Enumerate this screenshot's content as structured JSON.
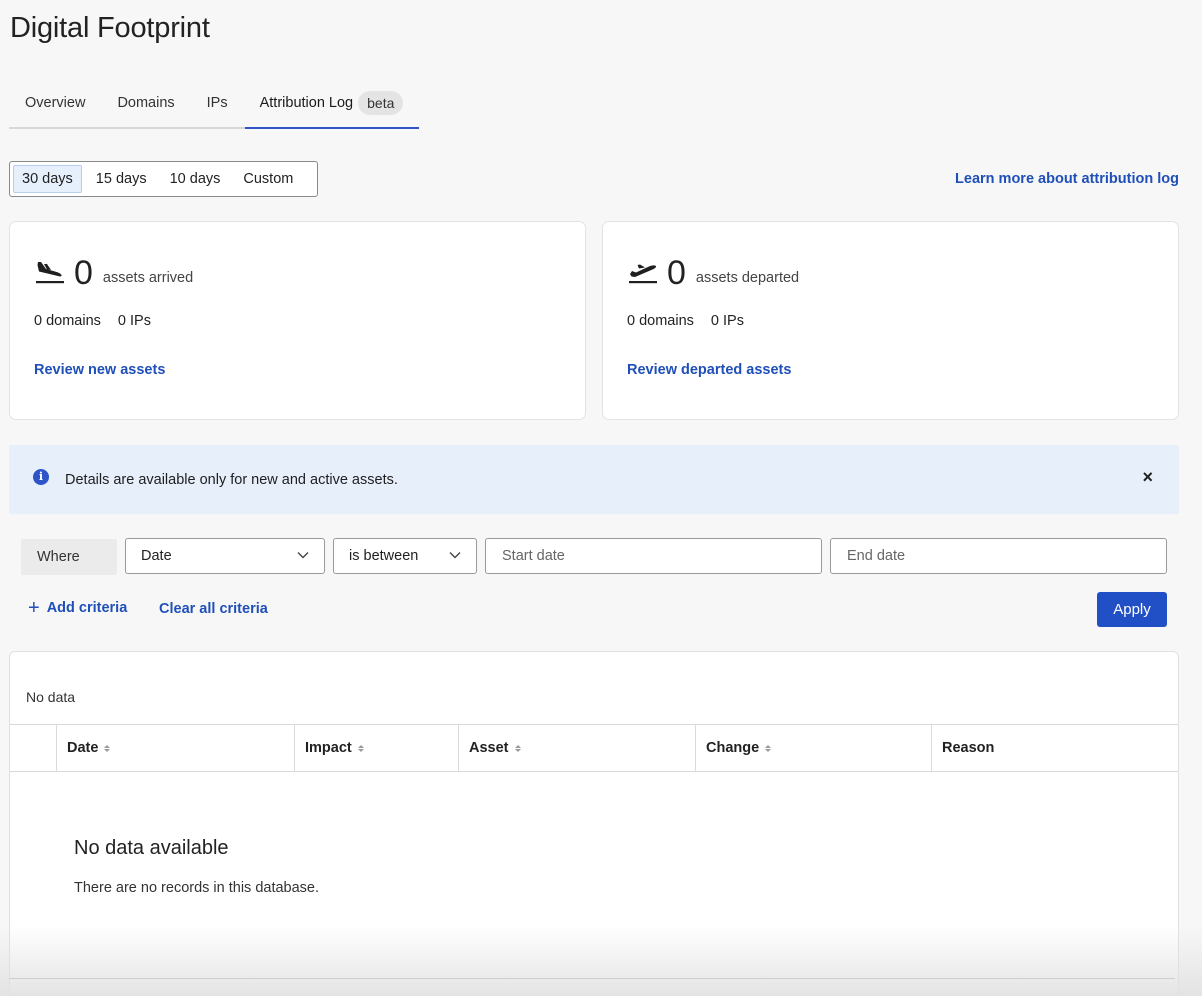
{
  "page": {
    "title": "Digital Footprint"
  },
  "tabs": [
    {
      "label": "Overview"
    },
    {
      "label": "Domains"
    },
    {
      "label": "IPs"
    },
    {
      "label": "Attribution Log",
      "badge": "beta",
      "active": true
    }
  ],
  "range": {
    "options": [
      "30 days",
      "15 days",
      "10 days",
      "Custom"
    ],
    "selected": "30 days"
  },
  "learn_more": "Learn more about attribution log",
  "cards": {
    "arrived": {
      "icon": "plane-arrival-icon",
      "count": "0",
      "caption": "assets arrived",
      "domains": "0 domains",
      "ips": "0 IPs",
      "link": "Review new assets"
    },
    "departed": {
      "icon": "plane-departure-icon",
      "count": "0",
      "caption": "assets departed",
      "domains": "0 domains",
      "ips": "0 IPs",
      "link": "Review departed assets"
    }
  },
  "banner": {
    "icon": "info-icon",
    "text": "Details are available only for new and active assets.",
    "close": "×"
  },
  "filter": {
    "where_label": "Where",
    "field": "Date",
    "operator": "is between",
    "start_placeholder": "Start date",
    "end_placeholder": "End date",
    "add_label": "Add criteria",
    "clear_label": "Clear all criteria",
    "apply_label": "Apply"
  },
  "table": {
    "status": "No data",
    "columns": [
      "Date",
      "Impact",
      "Asset",
      "Change",
      "Reason"
    ],
    "empty_title": "No data available",
    "empty_desc": "There are no records in this database.",
    "accent": "#2150c6"
  }
}
